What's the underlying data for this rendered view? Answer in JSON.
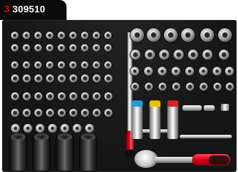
{
  "product_label": {
    "prefix": "3",
    "code": "309510"
  },
  "colors": {
    "label_background": "#0b0b0b",
    "label_prefix": "#e1001a",
    "label_code": "#ffffff",
    "tray_foam": "#151515",
    "handle_red": "#e1001a",
    "impact_band_blue": "#1f9bd8",
    "impact_band_yellow": "#f0c000",
    "impact_band_red": "#d8202c"
  },
  "tools": {
    "left_panel": "small-sockets-and-bits",
    "center": "t-bar-extension",
    "right_panel": "large-sockets",
    "bottom": [
      "deep-impact-sockets",
      "extension-bars",
      "ratchet"
    ]
  }
}
